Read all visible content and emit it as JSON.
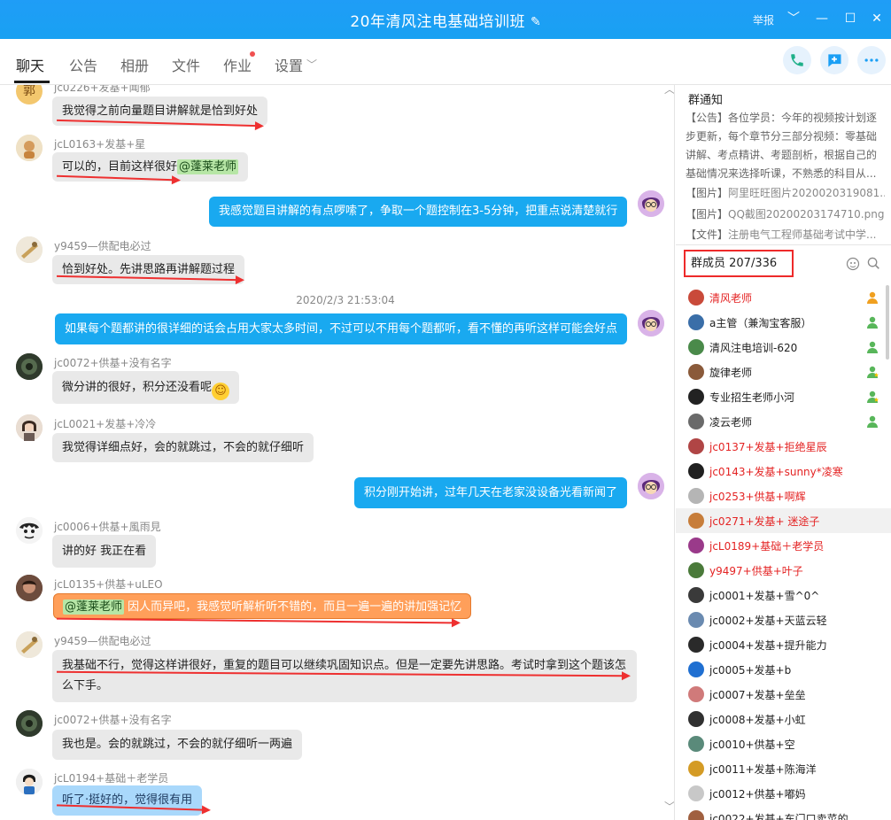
{
  "window": {
    "title": "20年清风注电基础培训班",
    "report_label": "举报",
    "controls": {
      "dropdown": "﹀",
      "minimize": "—",
      "maximize": "☐",
      "close": "✕"
    }
  },
  "tabs": [
    {
      "label": "聊天"
    },
    {
      "label": "公告"
    },
    {
      "label": "相册"
    },
    {
      "label": "文件"
    },
    {
      "label": "作业"
    },
    {
      "label": "设置"
    }
  ],
  "settings_caret": "﹀",
  "top_actions": {
    "phone_icon": "phone-icon",
    "add_chat_icon": "add-chat-icon",
    "more_icon": "more-icon"
  },
  "messages": [
    {
      "sender": "jc0226+发基+闻郁",
      "text": "我觉得之前向量题目讲解就是恰到好处",
      "avatar": "郭"
    },
    {
      "sender": "jcL0163+发基+星",
      "text": "可以的，目前这样很好",
      "mention": "@蓬莱老师"
    },
    {
      "sender": "",
      "text": "我感觉题目讲解的有点啰嗦了，争取一个题控制在3-5分钟，把重点说清楚就行",
      "mine": true
    },
    {
      "sender": "y9459—供配电必过",
      "text": "恰到好处。先讲思路再讲解题过程"
    },
    {
      "timestamp": "2020/2/3 21:53:04"
    },
    {
      "sender": "",
      "text": "如果每个题都讲的很详细的话会占用大家太多时间，不过可以不用每个题都听，看不懂的再听这样可能会好点",
      "mine": true
    },
    {
      "sender": "jc0072+供基+没有名字",
      "text": "微分讲的很好，积分还没看呢"
    },
    {
      "sender": "jcL0021+发基+冷冷",
      "text": "我觉得详细点好，会的就跳过，不会的就仔细听"
    },
    {
      "sender": "",
      "text": "积分刚开始讲，过年几天在老家没设备光看新闻了",
      "mine": true
    },
    {
      "sender": "jc0006+供基+風雨見",
      "text": "讲的好  我正在看"
    },
    {
      "sender": "jcL0135+供基+uLEO",
      "mention": "@蓬莱老师",
      "text": " 因人而异吧，我感觉听解析听不错的，而且一遍一遍的讲加强记忆"
    },
    {
      "sender": "y9459—供配电必过",
      "text_line1": "我基础不行，觉得这样讲很好，重复的题目可以继续巩固知识点。但是一定要先讲思路。考试时拿到这个题该怎",
      "text_line2": "么下手。"
    },
    {
      "sender": "jc0072+供基+没有名字",
      "text": "我也是。会的就跳过，不会的就仔细听一两遍"
    },
    {
      "sender": "jcL0194+基础＋老学员",
      "text": "听了·挺好的，觉得很有用"
    }
  ],
  "sidebar": {
    "notice_title": "群通知",
    "notice_body": "【公告】各位学员：今年的视频按计划逐步更新，每个章节分三部分视频：零基础讲解、考点精讲、考题剖析，根据自己的基础情况来选择听课，不熟悉的科目从...",
    "attachments": [
      {
        "label": "【图片】",
        "name": "阿里旺旺图片2020020319081..."
      },
      {
        "label": "【图片】",
        "name": "QQ截图20200203174710.png"
      },
      {
        "label": "【文件】",
        "name": "注册电气工程师基础考试中学..."
      }
    ],
    "members_label": "群成员 207/336",
    "members": [
      {
        "name": "清风老师",
        "red": true,
        "badge": "owner"
      },
      {
        "name": "a主管（兼淘宝客服）",
        "red": false,
        "badge": "admin"
      },
      {
        "name": "清风注电培训-620",
        "red": false,
        "badge": "admin"
      },
      {
        "name": "旋律老师",
        "red": false,
        "badge": "star"
      },
      {
        "name": "专业招生老师小河",
        "red": false,
        "badge": "star"
      },
      {
        "name": "凌云老师",
        "red": false,
        "badge": "admin"
      },
      {
        "name": "jc0137+发基+拒绝星辰",
        "red": true
      },
      {
        "name": "jc0143+发基+sunny*凌寒",
        "red": true
      },
      {
        "name": "jc0253+供基+啊辉",
        "red": true
      },
      {
        "name": "jc0271+发基+ 迷途子",
        "red": true,
        "selected": true
      },
      {
        "name": "jcL0189+基础＋老学员",
        "red": true
      },
      {
        "name": "y9497+供基+叶子",
        "red": true
      },
      {
        "name": "jc0001+发基+雪^0^",
        "red": false
      },
      {
        "name": "jc0002+发基+天蓝云轻",
        "red": false
      },
      {
        "name": "jc0004+发基+提升能力",
        "red": false
      },
      {
        "name": "jc0005+发基+b",
        "red": false
      },
      {
        "name": "jc0007+发基+垒垒",
        "red": false
      },
      {
        "name": "jc0008+发基+小虹",
        "red": false
      },
      {
        "name": "jc0010+供基+空",
        "red": false
      },
      {
        "name": "jc0011+发基+陈海洋",
        "red": false
      },
      {
        "name": "jc0012+供基+嘟妈",
        "red": false
      },
      {
        "name": "jc0022+发基+东门口卖菜的",
        "red": false
      }
    ]
  },
  "colors": {
    "accent": "#1a9ff5",
    "mine_bubble": "#19a9f0",
    "annotation_red": "#ee3030"
  }
}
